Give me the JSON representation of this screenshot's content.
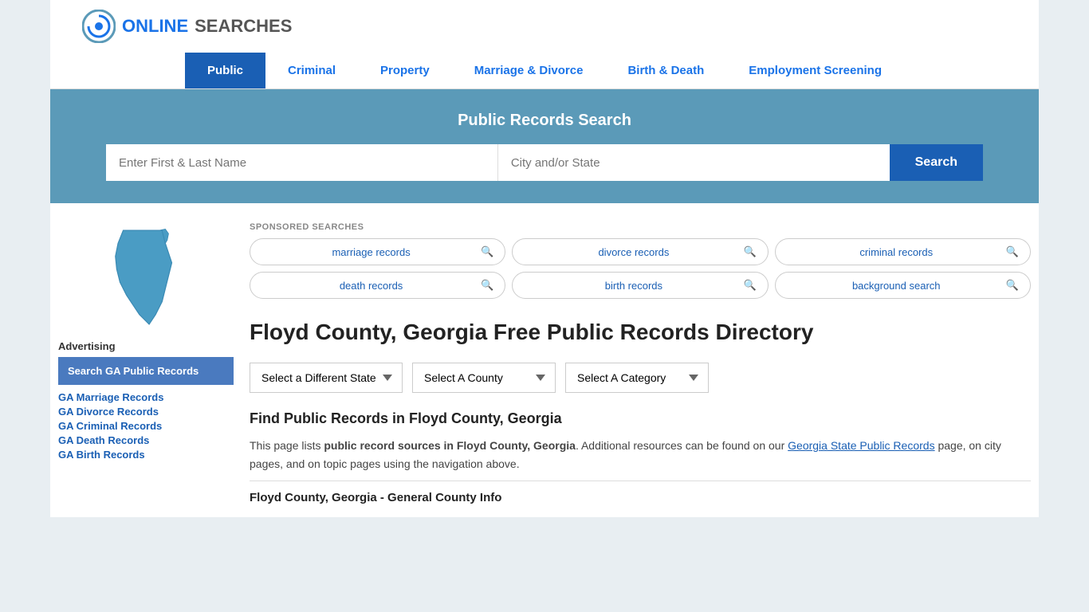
{
  "logo": {
    "text_online": "ONLINE",
    "text_searches": "SEARCHES"
  },
  "nav": {
    "items": [
      {
        "label": "Public",
        "active": true
      },
      {
        "label": "Criminal",
        "active": false
      },
      {
        "label": "Property",
        "active": false
      },
      {
        "label": "Marriage & Divorce",
        "active": false
      },
      {
        "label": "Birth & Death",
        "active": false
      },
      {
        "label": "Employment Screening",
        "active": false
      }
    ]
  },
  "search_banner": {
    "title": "Public Records Search",
    "name_placeholder": "Enter First & Last Name",
    "location_placeholder": "City and/or State",
    "button_label": "Search"
  },
  "sponsored": {
    "label": "SPONSORED SEARCHES",
    "items": [
      {
        "text": "marriage records"
      },
      {
        "text": "divorce records"
      },
      {
        "text": "criminal records"
      },
      {
        "text": "death records"
      },
      {
        "text": "birth records"
      },
      {
        "text": "background search"
      }
    ]
  },
  "sidebar": {
    "advertising_label": "Advertising",
    "ad_box_text": "Search GA Public Records",
    "links": [
      {
        "label": "GA Marriage Records"
      },
      {
        "label": "GA Divorce Records"
      },
      {
        "label": "GA Criminal Records"
      },
      {
        "label": "GA Death Records"
      },
      {
        "label": "GA Birth Records"
      }
    ]
  },
  "content": {
    "page_title": "Floyd County, Georgia Free Public Records Directory",
    "dropdowns": {
      "state_label": "Select a Different State",
      "county_label": "Select A County",
      "category_label": "Select A Category"
    },
    "find_title": "Find Public Records in Floyd County, Georgia",
    "find_text_1": "This page lists ",
    "find_text_bold": "public record sources in Floyd County, Georgia",
    "find_text_2": ". Additional resources can be found on our ",
    "find_link": "Georgia State Public Records",
    "find_text_3": " page, on city pages, and on topic pages using the navigation above.",
    "general_info_title": "Floyd County, Georgia - General County Info"
  }
}
